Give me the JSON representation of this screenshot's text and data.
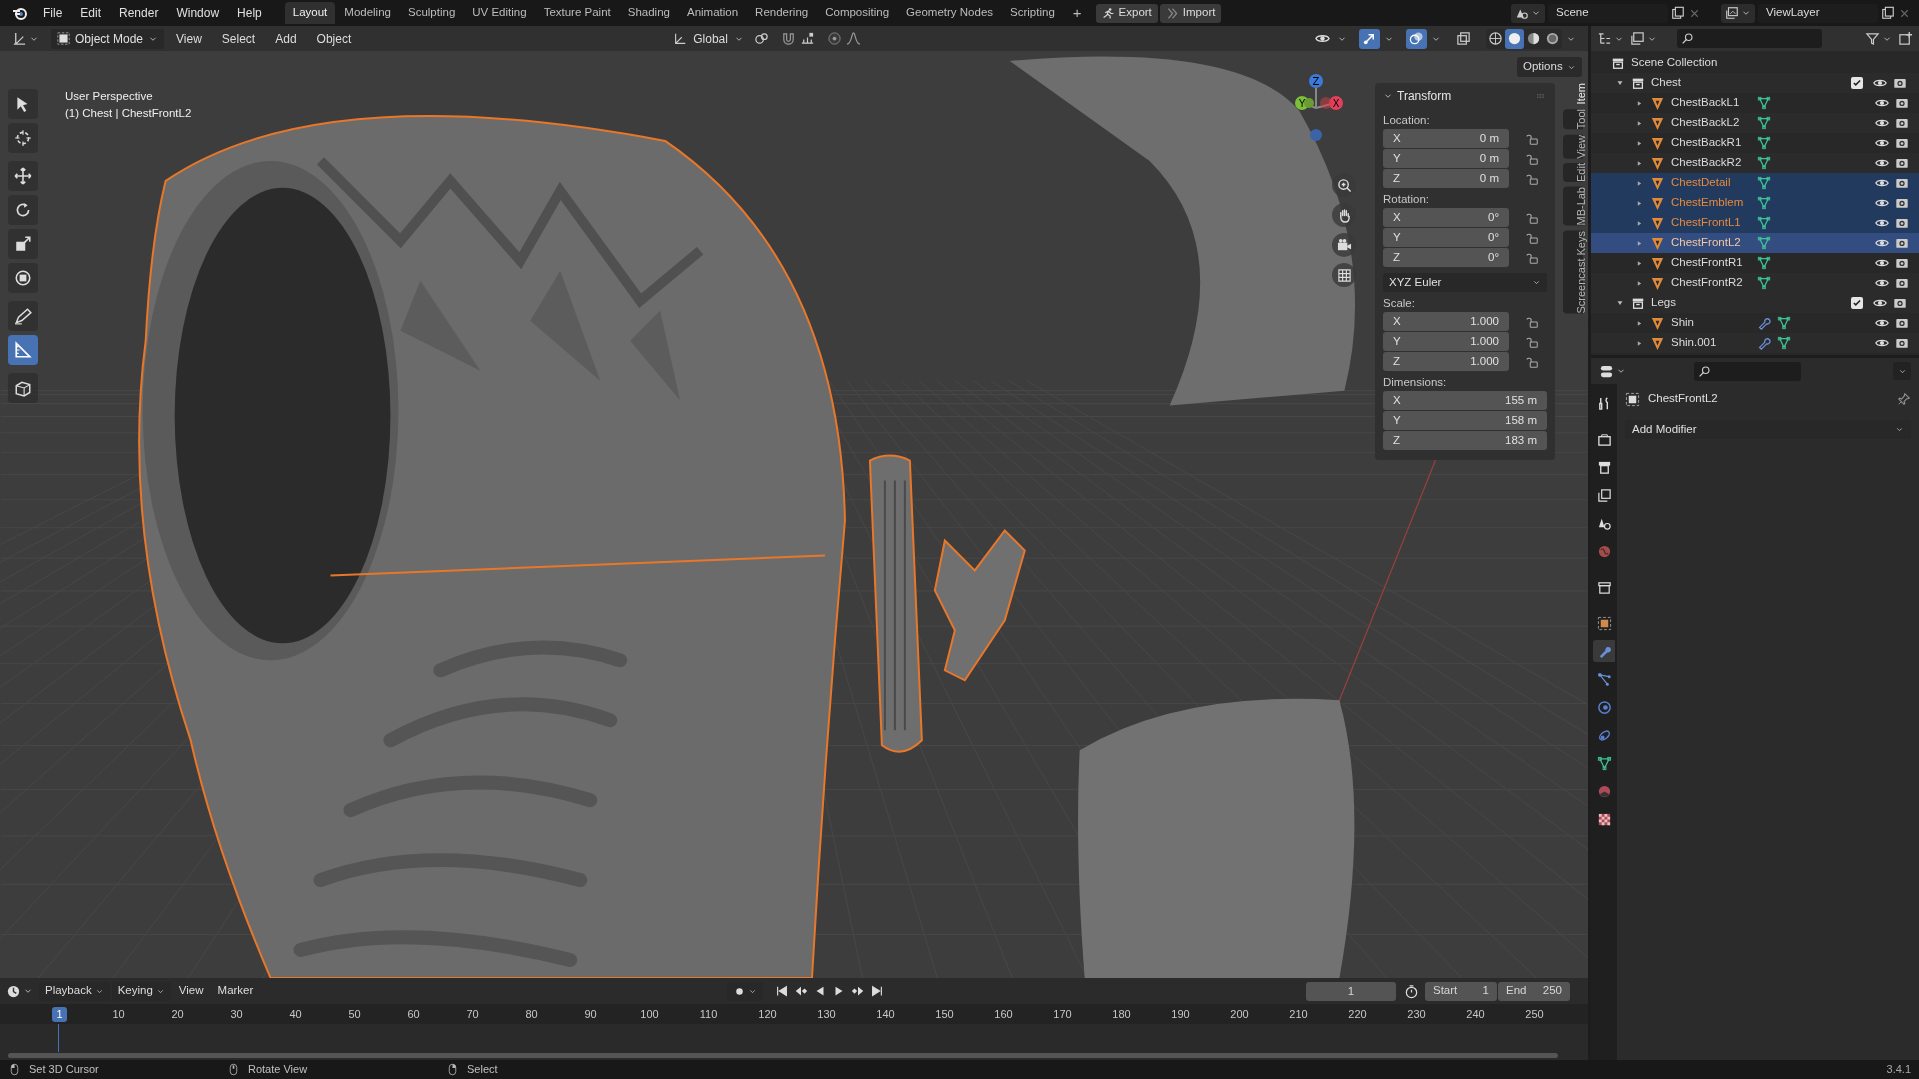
{
  "top_bar": {
    "menus": [
      "File",
      "Edit",
      "Render",
      "Window",
      "Help"
    ],
    "workspaces": [
      {
        "label": "Layout",
        "selected": true
      },
      {
        "label": "Modeling",
        "selected": false
      },
      {
        "label": "Sculpting",
        "selected": false
      },
      {
        "label": "UV Editing",
        "selected": false
      },
      {
        "label": "Texture Paint",
        "selected": false
      },
      {
        "label": "Shading",
        "selected": false
      },
      {
        "label": "Animation",
        "selected": false
      },
      {
        "label": "Rendering",
        "selected": false
      },
      {
        "label": "Compositing",
        "selected": false
      },
      {
        "label": "Geometry Nodes",
        "selected": false
      },
      {
        "label": "Scripting",
        "selected": false
      }
    ],
    "add_workspace": "+",
    "buttons": [
      "Export",
      "Import"
    ],
    "scene": "Scene",
    "view_layer": "ViewLayer"
  },
  "viewport_header": {
    "mode": "Object Mode",
    "menus": [
      "View",
      "Select",
      "Add",
      "Object"
    ],
    "orientation": "Global",
    "toggles": [
      {
        "kind": "visibility",
        "on": false
      },
      {
        "kind": "gizmo",
        "on": true
      },
      {
        "kind": "overlay",
        "on": true
      },
      {
        "kind": "xray",
        "on": false
      }
    ],
    "shading": [
      {
        "kind": "wireframe",
        "selected": false
      },
      {
        "kind": "solid",
        "selected": true
      },
      {
        "kind": "material",
        "selected": false
      },
      {
        "kind": "rendered",
        "selected": false
      }
    ]
  },
  "viewport": {
    "view_name": "User Perspective",
    "object_info": "(1) Chest | ChestFrontL2",
    "options": "Options",
    "gizmo_axes": [
      "Z",
      "Y",
      "X"
    ],
    "tools": [
      {
        "kind": "select",
        "selected": false
      },
      {
        "kind": "cursor",
        "selected": false
      },
      {
        "kind": "move",
        "selected": false
      },
      {
        "kind": "rotate",
        "selected": false
      },
      {
        "kind": "scale",
        "selected": false
      },
      {
        "kind": "transform",
        "selected": false
      },
      {
        "kind": "annotate",
        "selected": false
      },
      {
        "kind": "measure",
        "selected": true
      },
      {
        "kind": "add-cube",
        "selected": false
      }
    ]
  },
  "sidebar": {
    "tabs": [
      {
        "label": "Item",
        "selected": true
      },
      {
        "label": "Tool",
        "selected": false
      },
      {
        "label": "View",
        "selected": false
      },
      {
        "label": "Edit",
        "selected": false
      },
      {
        "label": "MB-Lab",
        "selected": false
      },
      {
        "label": "Screencast Keys",
        "selected": false
      }
    ],
    "panel_title": "Transform",
    "groups": [
      {
        "label": "Location:",
        "lockable": true,
        "rows": [
          {
            "axis": "X",
            "value": "0 m"
          },
          {
            "axis": "Y",
            "value": "0 m"
          },
          {
            "axis": "Z",
            "value": "0 m"
          }
        ]
      },
      {
        "label": "Rotation:",
        "lockable": true,
        "rows": [
          {
            "axis": "X",
            "value": "0°"
          },
          {
            "axis": "Y",
            "value": "0°"
          },
          {
            "axis": "Z",
            "value": "0°"
          }
        ],
        "mode": "XYZ Euler"
      },
      {
        "label": "Scale:",
        "lockable": true,
        "rows": [
          {
            "axis": "X",
            "value": "1.000"
          },
          {
            "axis": "Y",
            "value": "1.000"
          },
          {
            "axis": "Z",
            "value": "1.000"
          }
        ]
      },
      {
        "label": "Dimensions:",
        "lockable": false,
        "rows": [
          {
            "axis": "X",
            "value": "155 m"
          },
          {
            "axis": "Y",
            "value": "158 m"
          },
          {
            "axis": "Z",
            "value": "183 m"
          }
        ]
      }
    ]
  },
  "outliner": {
    "root": "Scene Collection",
    "collections": [
      {
        "name": "Chest",
        "checked": true,
        "expanded": true,
        "objects": [
          {
            "name": "ChestBackL1",
            "selected": false,
            "active": false,
            "modifier": false
          },
          {
            "name": "ChestBackL2",
            "selected": false,
            "active": false,
            "modifier": false
          },
          {
            "name": "ChestBackR1",
            "selected": false,
            "active": false,
            "modifier": false
          },
          {
            "name": "ChestBackR2",
            "selected": false,
            "active": false,
            "modifier": false
          },
          {
            "name": "ChestDetail",
            "selected": true,
            "active": false,
            "modifier": false
          },
          {
            "name": "ChestEmblem",
            "selected": true,
            "active": false,
            "modifier": false
          },
          {
            "name": "ChestFrontL1",
            "selected": true,
            "active": false,
            "modifier": false
          },
          {
            "name": "ChestFrontL2",
            "selected": true,
            "active": true,
            "modifier": false
          },
          {
            "name": "ChestFrontR1",
            "selected": false,
            "active": false,
            "modifier": false
          },
          {
            "name": "ChestFrontR2",
            "selected": false,
            "active": false,
            "modifier": false
          }
        ]
      },
      {
        "name": "Legs",
        "checked": true,
        "expanded": true,
        "objects": [
          {
            "name": "Shin",
            "selected": false,
            "active": false,
            "modifier": true
          },
          {
            "name": "Shin.001",
            "selected": false,
            "active": false,
            "modifier": true
          }
        ]
      }
    ]
  },
  "properties": {
    "tabs": [
      {
        "kind": "tool",
        "selected": false
      },
      {
        "kind": "render",
        "selected": false
      },
      {
        "kind": "output",
        "selected": false
      },
      {
        "kind": "view-layer",
        "selected": false
      },
      {
        "kind": "scene",
        "selected": false
      },
      {
        "kind": "world",
        "selected": false
      },
      {
        "kind": "collection",
        "selected": false
      },
      {
        "kind": "object",
        "selected": false
      },
      {
        "kind": "modifiers",
        "selected": true
      },
      {
        "kind": "particles",
        "selected": false
      },
      {
        "kind": "physics",
        "selected": false
      },
      {
        "kind": "constraints",
        "selected": false
      },
      {
        "kind": "data",
        "selected": false
      },
      {
        "kind": "material",
        "selected": false
      },
      {
        "kind": "texture",
        "selected": false
      }
    ],
    "object_name": "ChestFrontL2",
    "add_modifier": "Add Modifier"
  },
  "timeline": {
    "menus": [
      "Playback",
      "Keying",
      "View",
      "Marker"
    ],
    "current_frame": "1",
    "start_label": "Start",
    "start": "1",
    "end_label": "End",
    "end": "250",
    "playhead": "1",
    "ruler": [
      "10",
      "20",
      "30",
      "40",
      "50",
      "60",
      "70",
      "80",
      "90",
      "100",
      "110",
      "120",
      "130",
      "140",
      "150",
      "160",
      "170",
      "180",
      "190",
      "200",
      "210",
      "220",
      "230",
      "240",
      "250"
    ]
  },
  "status_bar": {
    "hints": [
      {
        "kind": "left",
        "text": "Set 3D Cursor"
      },
      {
        "kind": "middle",
        "text": "Rotate View"
      },
      {
        "kind": "right",
        "text": "Select"
      }
    ],
    "version": "3.4.1"
  }
}
